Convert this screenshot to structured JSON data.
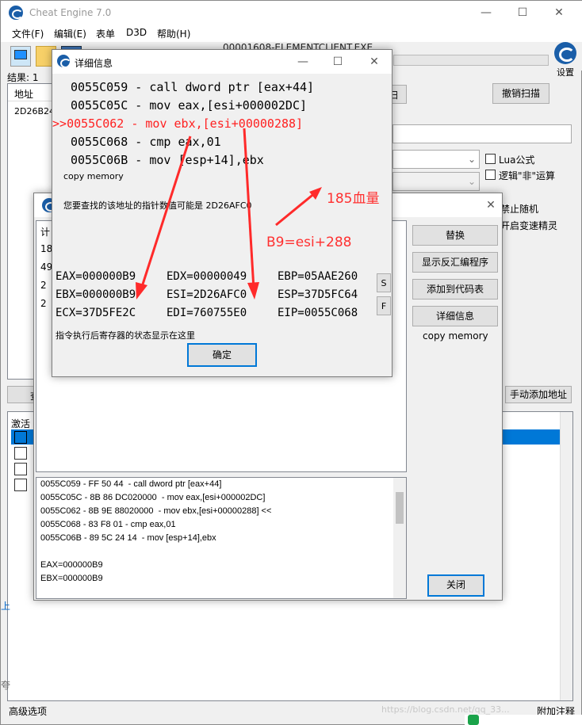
{
  "app": {
    "title": "Cheat Engine 7.0",
    "process": "00001608-ELEMENTCLIENT.EXE"
  },
  "menu": [
    "文件(F)",
    "编辑(E)",
    "表单",
    "D3D",
    "帮助(H)"
  ],
  "toolbar": {
    "settings_label": "设置"
  },
  "results": {
    "count_label": "结果: 1",
    "col_address": "地址",
    "row_address": "2D26B24"
  },
  "scan": {
    "undo_label": "撤销扫描",
    "hidden_label": "扫",
    "lua_label": "Lua公式",
    "not_label": "逻辑\"非\"运算",
    "random_label": "禁止随机",
    "speed_label": "开启变速精灵"
  },
  "bottom": {
    "add_address": "手动添加地址",
    "view_label": "查",
    "active_col": "激活",
    "advanced": "高级选项",
    "append": "附加注释",
    "watermark": "https://blog.csdn.net/qq_33...",
    "left_char": "上",
    "left_char2": "夸"
  },
  "detail": {
    "title": "详细信息",
    "lines": [
      {
        "prefix": "",
        "text": "0055C059 - call dword ptr [eax+44]"
      },
      {
        "prefix": "",
        "text": "0055C05C - mov eax,[esi+000002DC]"
      },
      {
        "prefix": ">>",
        "text": "0055C062 - mov ebx,[esi+00000288]"
      },
      {
        "prefix": "",
        "text": "0055C068 - cmp eax,01"
      },
      {
        "prefix": "",
        "text": "0055C06B - mov [esp+14],ebx"
      }
    ],
    "copy_memory": "copy memory",
    "pointer_hint": "您要查找的该地址的指针数值可能是 2D26AFC0",
    "registers": [
      [
        "EAX=000000B9",
        "EDX=00000049",
        "EBP=05AAE260"
      ],
      [
        "EBX=000000B9",
        "ESI=2D26AFC0",
        "ESP=37D5FC64"
      ],
      [
        "ECX=37D5FE2C",
        "EDI=760755E0",
        "EIP=0055C068"
      ]
    ],
    "state_hint": "指令执行后寄存器的状态显示在这里",
    "ok": "确定",
    "s_btn": "S",
    "f_btn": "F"
  },
  "annotations": {
    "blood": "185血量",
    "formula": "B9=esi+288",
    "color": "#ff3030"
  },
  "finder": {
    "col_count": "计",
    "rows": [
      "18",
      "49",
      "2",
      "2"
    ],
    "replace": "替换",
    "show_disasm": "显示反汇编程序",
    "add_to_code": "添加到代码表",
    "details": "详细信息",
    "copy_memory": "copy memory",
    "close": "关闭",
    "code_lines": [
      "0055C059 - FF 50 44  - call dword ptr [eax+44]",
      "0055C05C - 8B 86 DC020000  - mov eax,[esi+000002DC]",
      "0055C062 - 8B 9E 88020000  - mov ebx,[esi+00000288] <<",
      "0055C068 - 83 F8 01 - cmp eax,01",
      "0055C06B - 89 5C 24 14  - mov [esp+14],ebx",
      "",
      "EAX=000000B9",
      "EBX=000000B9"
    ]
  },
  "colors": {
    "accent": "#0078d7",
    "red": "#ff2020",
    "selected_row": "#0078d7"
  }
}
